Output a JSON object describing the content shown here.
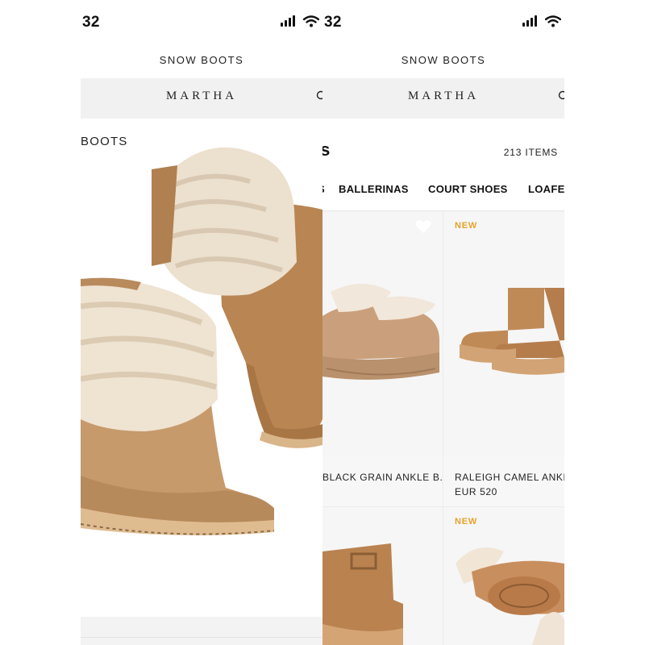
{
  "left_screen": {
    "status": {
      "time": "32"
    },
    "section_title": "SNOW BOOTS",
    "brand": "MARTHA",
    "hero_label": "BOOTS",
    "hero_image": "shearling-boots-photo"
  },
  "right_screen": {
    "status": {
      "time": "32"
    },
    "section_title": "SNOW BOOTS",
    "brand": "MARTHA",
    "category_title": "oes",
    "item_count": "213 ITEMS",
    "filters": [
      {
        "label": "S"
      },
      {
        "label": "BALLERINAS"
      },
      {
        "label": "COURT SHOES"
      },
      {
        "label": "LOAFE"
      }
    ],
    "products": [
      {
        "name": "BLACK GRAIN ANKLE B...",
        "price": "",
        "badge": "",
        "image": "shearling-slip-on-clog"
      },
      {
        "name": "RALEIGH CAMEL ANKLE B",
        "price": "EUR 520",
        "badge": "NEW",
        "image": "platform-ankle-boot"
      },
      {
        "name": "",
        "price": "",
        "badge": "",
        "image": "buckle-ankle-boot"
      },
      {
        "name": "",
        "price": "",
        "badge": "NEW",
        "image": "shearling-slippers"
      }
    ]
  },
  "colors": {
    "brand_bar": "#f1f1f1",
    "new_badge": "#e9a32a",
    "suede": "#c08a57",
    "fur": "#efe4d5"
  }
}
